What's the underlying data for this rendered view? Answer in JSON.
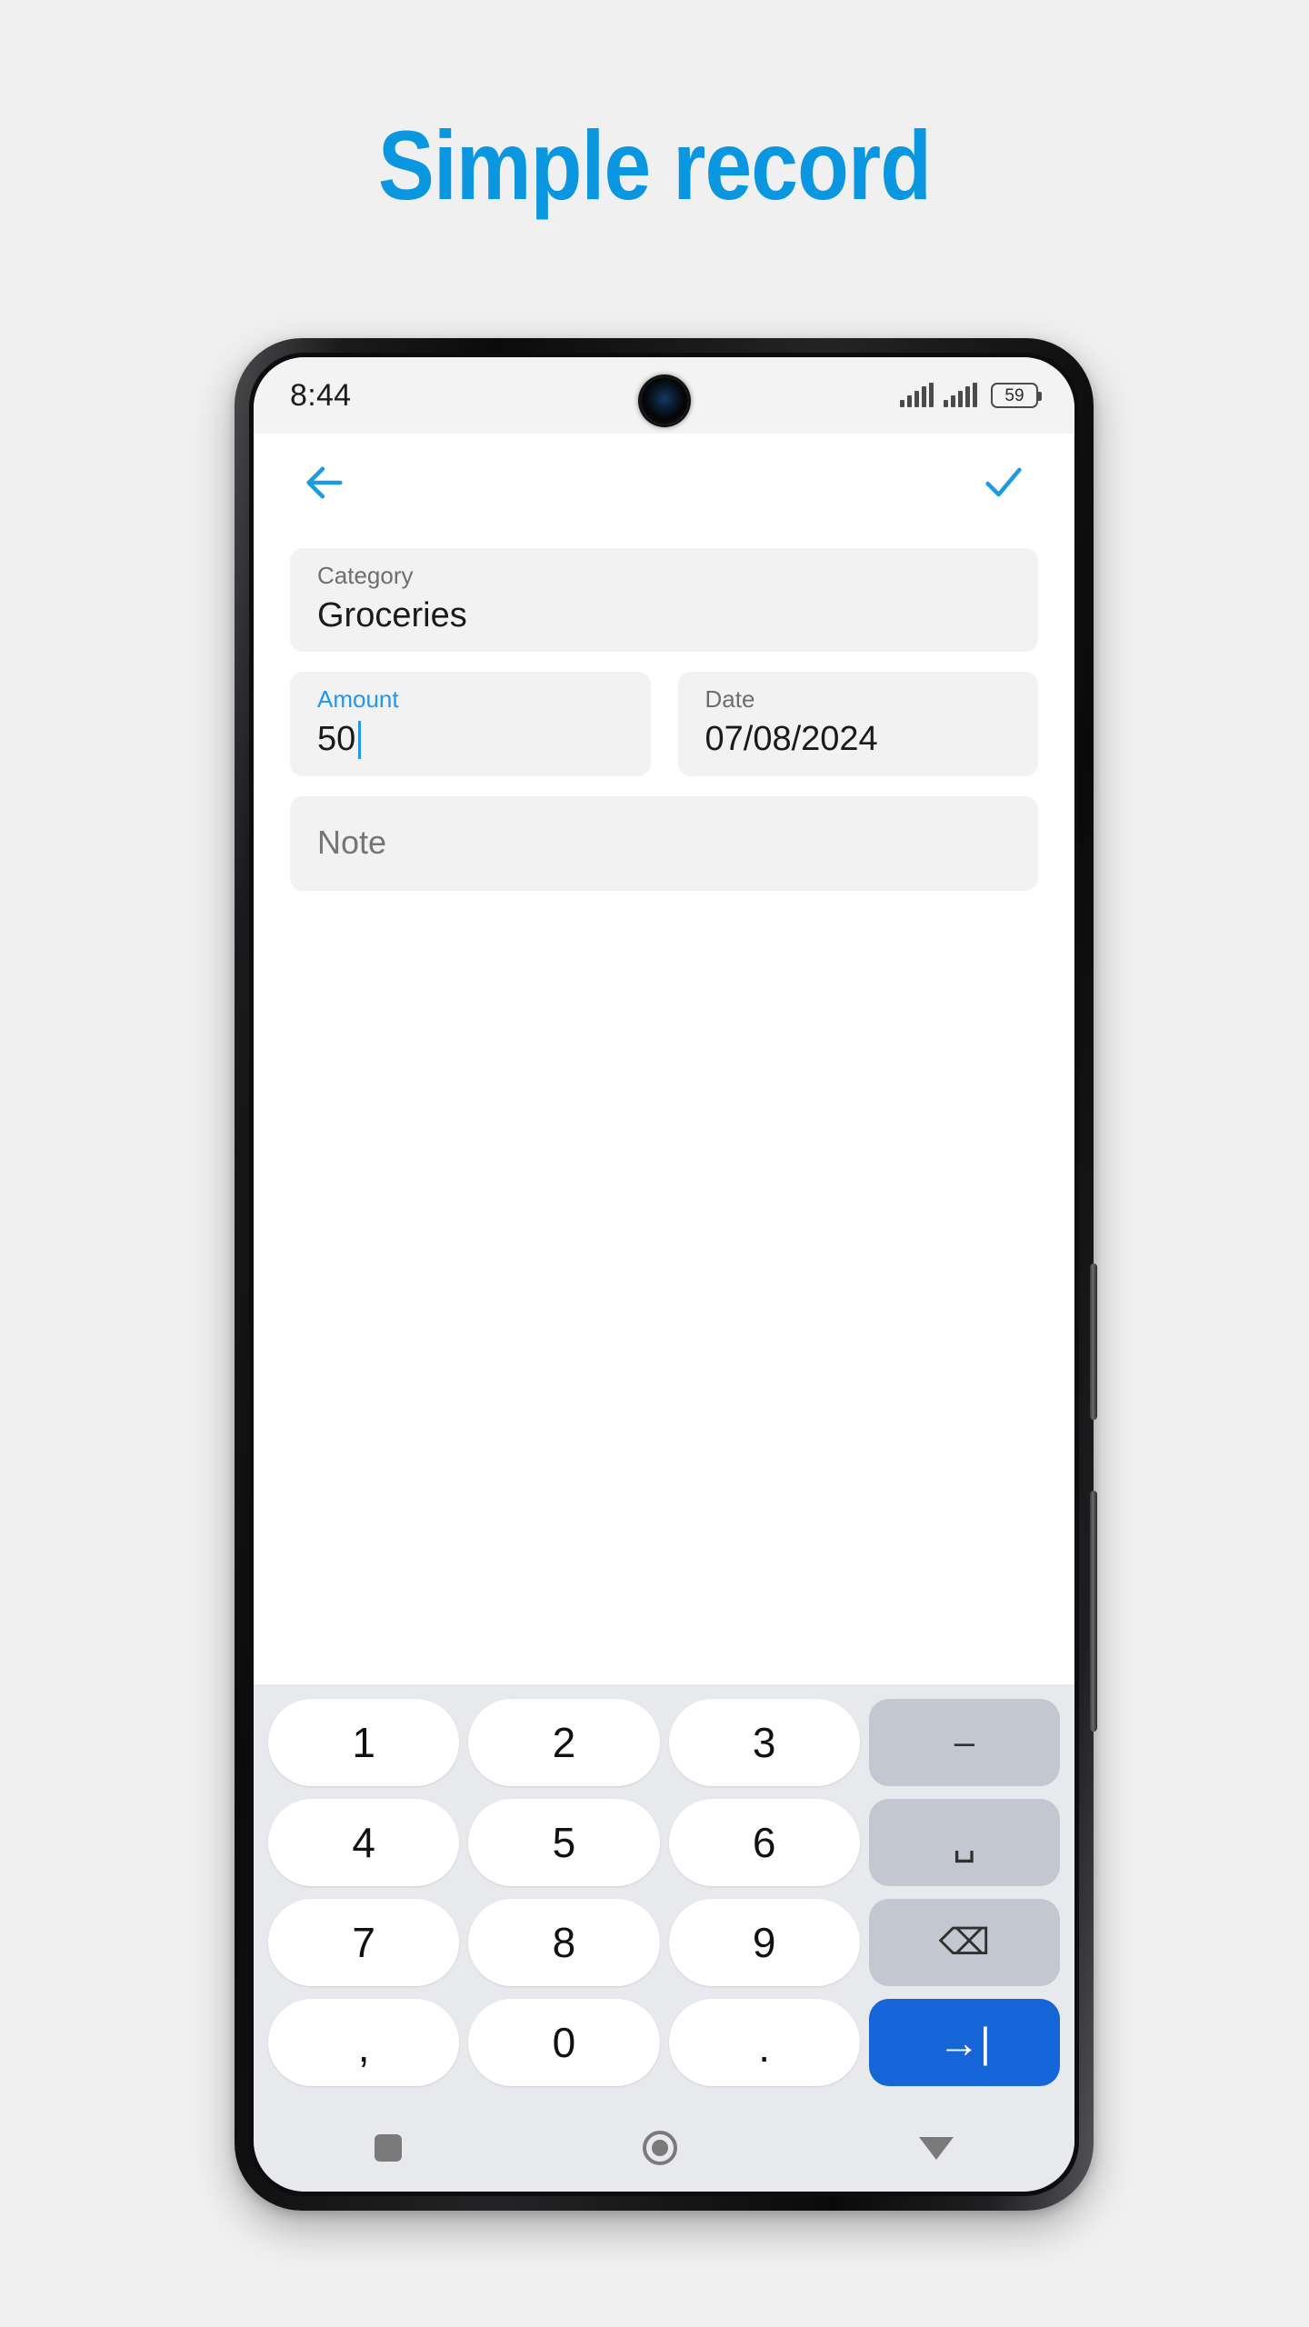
{
  "headline": {
    "text": "Simple record",
    "color": "#0b97e0"
  },
  "statusbar": {
    "time": "8:44",
    "battery_percent": "59",
    "signal_icon_1": "signal-bars-icon",
    "signal_icon_2": "signal-bars-icon",
    "battery_icon": "battery-icon",
    "camera_icon": "front-camera-punchhole"
  },
  "appbar": {
    "back_icon": "arrow-left-icon",
    "confirm_icon": "check-icon",
    "accent": "#1e9ae0"
  },
  "form": {
    "category": {
      "label": "Category",
      "value": "Groceries",
      "focused": false
    },
    "amount": {
      "label": "Amount",
      "value": "50",
      "focused": true,
      "focus_color": "#2196f3"
    },
    "date": {
      "label": "Date",
      "value": "07/08/2024",
      "focused": false
    },
    "note": {
      "placeholder": "Note",
      "value": ""
    }
  },
  "keyboard": {
    "background": "#e7e9ec",
    "rows": [
      [
        {
          "label": "1",
          "type": "digit",
          "name": "key-1"
        },
        {
          "label": "2",
          "type": "digit",
          "name": "key-2"
        },
        {
          "label": "3",
          "type": "digit",
          "name": "key-3"
        },
        {
          "label": "–",
          "type": "fn",
          "name": "key-minus"
        }
      ],
      [
        {
          "label": "4",
          "type": "digit",
          "name": "key-4"
        },
        {
          "label": "5",
          "type": "digit",
          "name": "key-5"
        },
        {
          "label": "6",
          "type": "digit",
          "name": "key-6"
        },
        {
          "label": "␣",
          "type": "fn",
          "name": "key-space"
        }
      ],
      [
        {
          "label": "7",
          "type": "digit",
          "name": "key-7"
        },
        {
          "label": "8",
          "type": "digit",
          "name": "key-8"
        },
        {
          "label": "9",
          "type": "digit",
          "name": "key-9"
        },
        {
          "label": "⌫",
          "type": "fn",
          "name": "key-backspace"
        }
      ],
      [
        {
          "label": ",",
          "type": "digit",
          "name": "key-comma"
        },
        {
          "label": "0",
          "type": "digit",
          "name": "key-0"
        },
        {
          "label": ".",
          "type": "digit",
          "name": "key-period"
        },
        {
          "label": "→|",
          "type": "action",
          "name": "key-next"
        }
      ]
    ],
    "action_color": "#1565d8"
  },
  "navbar": {
    "recents_icon": "square-recents-icon",
    "home_icon": "circle-home-icon",
    "back_icon": "triangle-down-back-icon"
  }
}
